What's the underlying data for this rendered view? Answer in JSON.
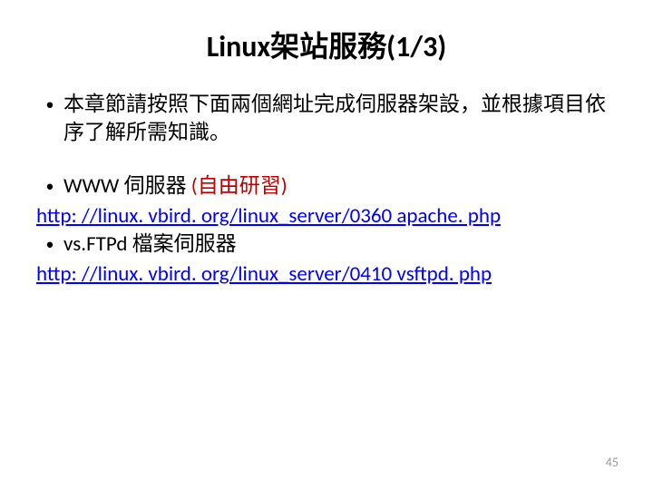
{
  "title": "Linux架站服務(1/3)",
  "intro": "本章節請按照下面兩個網址完成伺服器架設，並根據項目依序了解所需知識。",
  "item1_label": "WWW 伺服器 ",
  "item1_note": "(自由研習)",
  "link1": "http: //linux. vbird. org/linux_server/0360 apache. php",
  "item2_label": "vs.FTPd 檔案伺服器",
  "link2": "http: //linux. vbird. org/linux_server/0410 vsftpd. php",
  "page_number": "45"
}
